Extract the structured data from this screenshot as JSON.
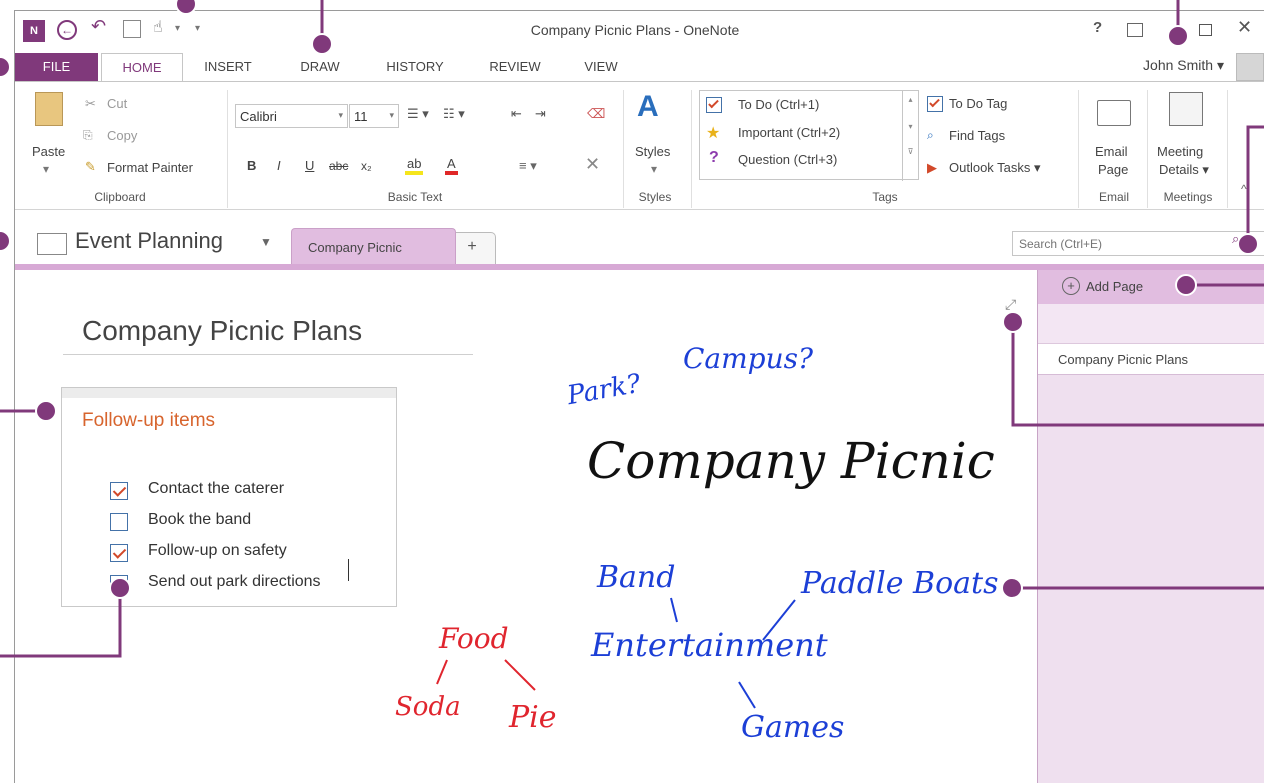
{
  "window": {
    "title": "Company Picnic Plans - OneNote",
    "user": "John Smith",
    "help_icon": "?",
    "controls": [
      "restore-ribbon",
      "maximize",
      "close"
    ]
  },
  "ribbon_tabs": [
    "FILE",
    "HOME",
    "INSERT",
    "DRAW",
    "HISTORY",
    "REVIEW",
    "VIEW"
  ],
  "clipboard": {
    "paste": "Paste",
    "cut": "Cut",
    "copy": "Copy",
    "format_painter": "Format Painter",
    "label": "Clipboard"
  },
  "basic_text": {
    "font": "Calibri",
    "size": "11",
    "bold": "B",
    "italic": "I",
    "underline": "U",
    "strike": "abc",
    "subscript": "x₂",
    "label": "Basic Text"
  },
  "styles": {
    "button": "Styles",
    "label": "Styles"
  },
  "tags": {
    "items": [
      "To Do (Ctrl+1)",
      "Important (Ctrl+2)",
      "Question (Ctrl+3)"
    ],
    "todo_tag": "To Do Tag",
    "find_tags": "Find Tags",
    "outlook_tasks": "Outlook Tasks",
    "label": "Tags"
  },
  "email": {
    "button_line1": "Email",
    "button_line2": "Page",
    "label": "Email"
  },
  "meetings": {
    "button_line1": "Meeting",
    "button_line2": "Details",
    "label": "Meetings"
  },
  "notebook": {
    "name": "Event Planning",
    "section": "Company Picnic",
    "add_section": "+"
  },
  "search": {
    "placeholder": "Search (Ctrl+E)"
  },
  "page": {
    "title": "Company Picnic Plans",
    "note_heading": "Follow-up items",
    "todos": [
      {
        "text": "Contact the caterer",
        "checked": true
      },
      {
        "text": "Book the band",
        "checked": false
      },
      {
        "text": "Follow-up on safety",
        "checked": true
      },
      {
        "text": "Send out park directions",
        "checked": false
      }
    ]
  },
  "ink": {
    "park": "Park?",
    "campus": "Campus?",
    "main": "Company Picnic",
    "band": "Band",
    "paddle": "Paddle Boats",
    "entertainment": "Entertainment",
    "games": "Games",
    "food": "Food",
    "soda": "Soda",
    "pie": "Pie",
    "blue_color": "#1c3fd6",
    "red_color": "#e0252e",
    "black_color": "#111111"
  },
  "page_pane": {
    "add_page": "Add Page",
    "pages": [
      "Company Picnic Plans"
    ]
  },
  "accent_color": "#80397b"
}
